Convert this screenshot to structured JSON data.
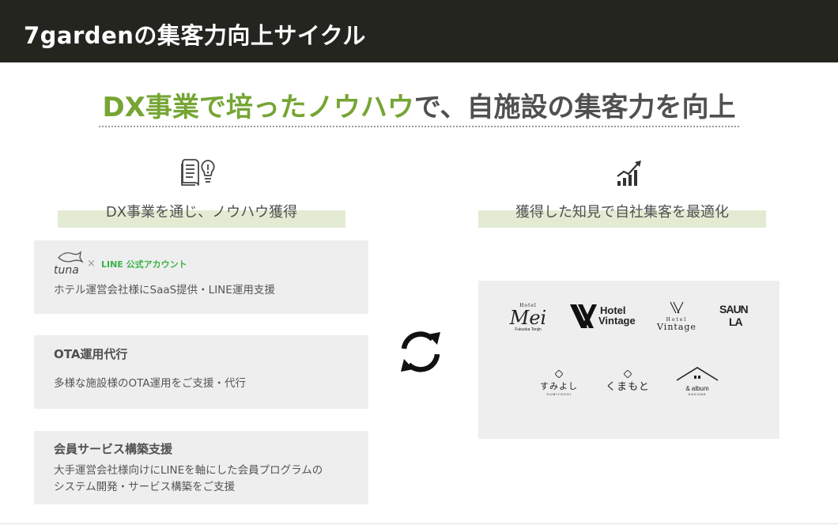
{
  "header": {
    "title": "7gardenの集客力向上サイクル"
  },
  "headline": {
    "green": "DX事業で培ったノウハウ",
    "gray": "で、自施設の集客力を向上"
  },
  "left_column": {
    "heading": "DX事業を通じ、ノウハウ獲得",
    "icon": "book-lightbulb-icon",
    "cards": [
      {
        "logo_tuna": "tuna",
        "logo_times": "×",
        "logo_line": "LINE 公式アカウント",
        "desc": "ホテル運営会社様にSaaS提供・LINE運用支援"
      },
      {
        "title": "OTA運用代行",
        "desc": "多様な施設様のOTA運用をご支援・代行"
      },
      {
        "title": "会員サービス構築支援",
        "desc_line1": "大手運営会社様向けにLINEを軸にした会員プログラムの",
        "desc_line2": "システム開発・サービス構築をご支援"
      }
    ]
  },
  "right_column": {
    "heading": "獲得した知見で自社集客を最適化",
    "icon": "growth-chart-icon",
    "logos": {
      "mei_top": "Hotel",
      "mei_main": "Mei",
      "mei_sub": "Fukuoka Tenjin",
      "vintage1_a": "Hotel",
      "vintage1_b": "Vintage",
      "vintage2_top": "Hotel",
      "vintage2_main": "Vintage",
      "sauna_a": "SAUN",
      "sauna_b": "LA",
      "sumiyoshi_main": "すみよし",
      "sumiyoshi_sub": "SUMIYOSHI",
      "kumamoto_main": "くまもと",
      "album_main": "& album",
      "album_sub": "HAKONE"
    }
  },
  "center": {
    "icon": "cycle-arrows-icon"
  },
  "colors": {
    "header_bg": "#252520",
    "accent_green": "#76a534",
    "heading_band": "#e3ecd3",
    "card_bg": "#eeeeee",
    "line_green": "#3bb24a"
  }
}
